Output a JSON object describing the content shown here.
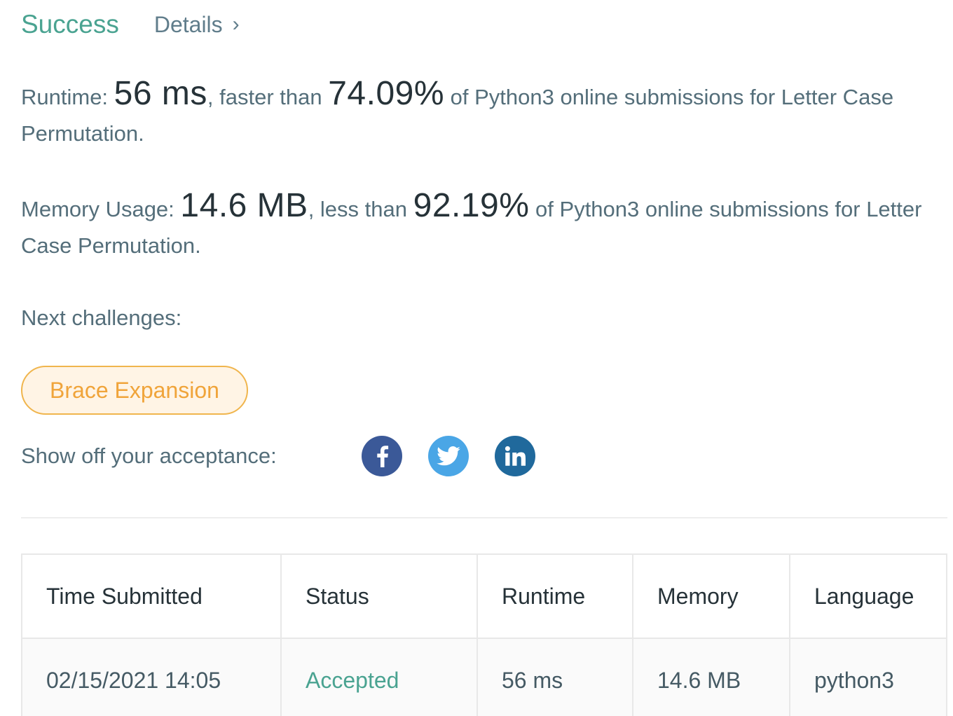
{
  "header": {
    "status": "Success",
    "details_label": "Details",
    "chevron": "›"
  },
  "runtime": {
    "label": "Runtime:",
    "value": "56 ms",
    "comparison": ", faster than",
    "percent": "74.09%",
    "suffix": "of Python3 online submissions for Letter Case Permutation."
  },
  "memory": {
    "label": "Memory Usage:",
    "value": "14.6 MB",
    "comparison": ", less than",
    "percent": "92.19%",
    "suffix": "of Python3 online submissions for Letter Case Permutation."
  },
  "next": {
    "label": "Next challenges:",
    "challenges": [
      "Brace Expansion"
    ]
  },
  "share": {
    "label": "Show off your acceptance:",
    "icons": [
      "facebook-icon",
      "twitter-icon",
      "linkedin-icon"
    ]
  },
  "table": {
    "headers": [
      "Time Submitted",
      "Status",
      "Runtime",
      "Memory",
      "Language"
    ],
    "rows": [
      [
        "02/15/2021 14:05",
        "Accepted",
        "56 ms",
        "14.6 MB",
        "python3"
      ]
    ]
  },
  "colors": {
    "success": "#4aa391",
    "challenge_border": "#f0b54d",
    "facebook": "#3b5998",
    "twitter": "#4aa6e6",
    "linkedin": "#20699c"
  }
}
